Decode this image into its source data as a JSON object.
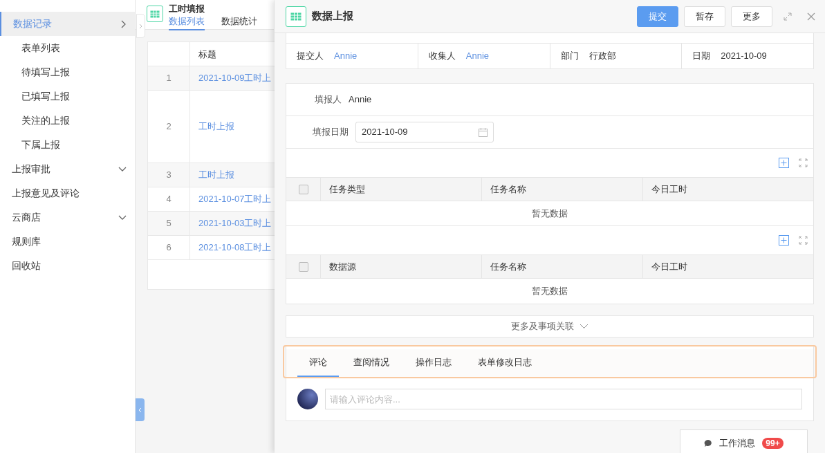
{
  "sidebar": {
    "items": [
      {
        "label": "数据记录",
        "selected": true,
        "expanded": true,
        "children": [
          {
            "label": "表单列表",
            "selected": false
          },
          {
            "label": "待填写上报",
            "selected": false
          },
          {
            "label": "已填写上报",
            "selected": false
          },
          {
            "label": "关注的上报",
            "selected": false
          },
          {
            "label": "下属上报",
            "selected": false
          }
        ]
      },
      {
        "label": "上报审批",
        "selected": false,
        "expanded": false
      },
      {
        "label": "上报意见及评论",
        "selected": false
      },
      {
        "label": "云商店",
        "selected": false,
        "expanded": false
      },
      {
        "label": "规则库",
        "selected": false
      },
      {
        "label": "回收站",
        "selected": false
      }
    ]
  },
  "list_page": {
    "title": "工时填报",
    "tabs": [
      {
        "label": "数据列表",
        "selected": true
      },
      {
        "label": "数据统计",
        "selected": false
      }
    ],
    "table": {
      "columns": [
        "标题"
      ],
      "rows": [
        {
          "index": "1",
          "title": "2021-10-09工时上",
          "tall": false
        },
        {
          "index": "2",
          "title": "工时上报",
          "tall": true
        },
        {
          "index": "3",
          "title": "工时上报",
          "tall": false
        },
        {
          "index": "4",
          "title": "2021-10-07工时上",
          "tall": false
        },
        {
          "index": "5",
          "title": "2021-10-03工时上",
          "tall": false
        },
        {
          "index": "6",
          "title": "2021-10-08工时上",
          "tall": false
        }
      ]
    }
  },
  "drawer": {
    "title": "数据上报",
    "buttons": [
      {
        "label": "提交",
        "kind": "primary"
      },
      {
        "label": "暂存",
        "kind": "default"
      },
      {
        "label": "更多",
        "kind": "default"
      }
    ],
    "info": [
      {
        "label": "提交人",
        "value": "Annie",
        "kind": "link"
      },
      {
        "label": "收集人",
        "value": "Annie",
        "kind": "link"
      },
      {
        "label": "部门",
        "value": "行政部",
        "kind": "text"
      },
      {
        "label": "日期",
        "value": "2021-10-09",
        "kind": "text"
      }
    ],
    "form": {
      "filler_label": "填报人",
      "filler": "Annie",
      "date_label": "填报日期",
      "date": "2021-10-09"
    },
    "subtables": [
      {
        "columns": [
          "任务类型",
          "任务名称",
          "今日工时"
        ],
        "checked": false,
        "empty_text": "暂无数据"
      },
      {
        "columns": [
          "数据源",
          "任务名称",
          "今日工时"
        ],
        "checked": false,
        "empty_text": "暂无数据"
      }
    ],
    "more_link": "更多及事项关联",
    "tabs": [
      {
        "label": "评论",
        "selected": true
      },
      {
        "label": "查阅情况",
        "selected": false
      },
      {
        "label": "操作日志",
        "selected": false
      },
      {
        "label": "表单修改日志",
        "selected": false
      }
    ],
    "comment_placeholder": "请输入评论内容..."
  },
  "work_message": {
    "label": "工作消息",
    "badge": "99+"
  }
}
